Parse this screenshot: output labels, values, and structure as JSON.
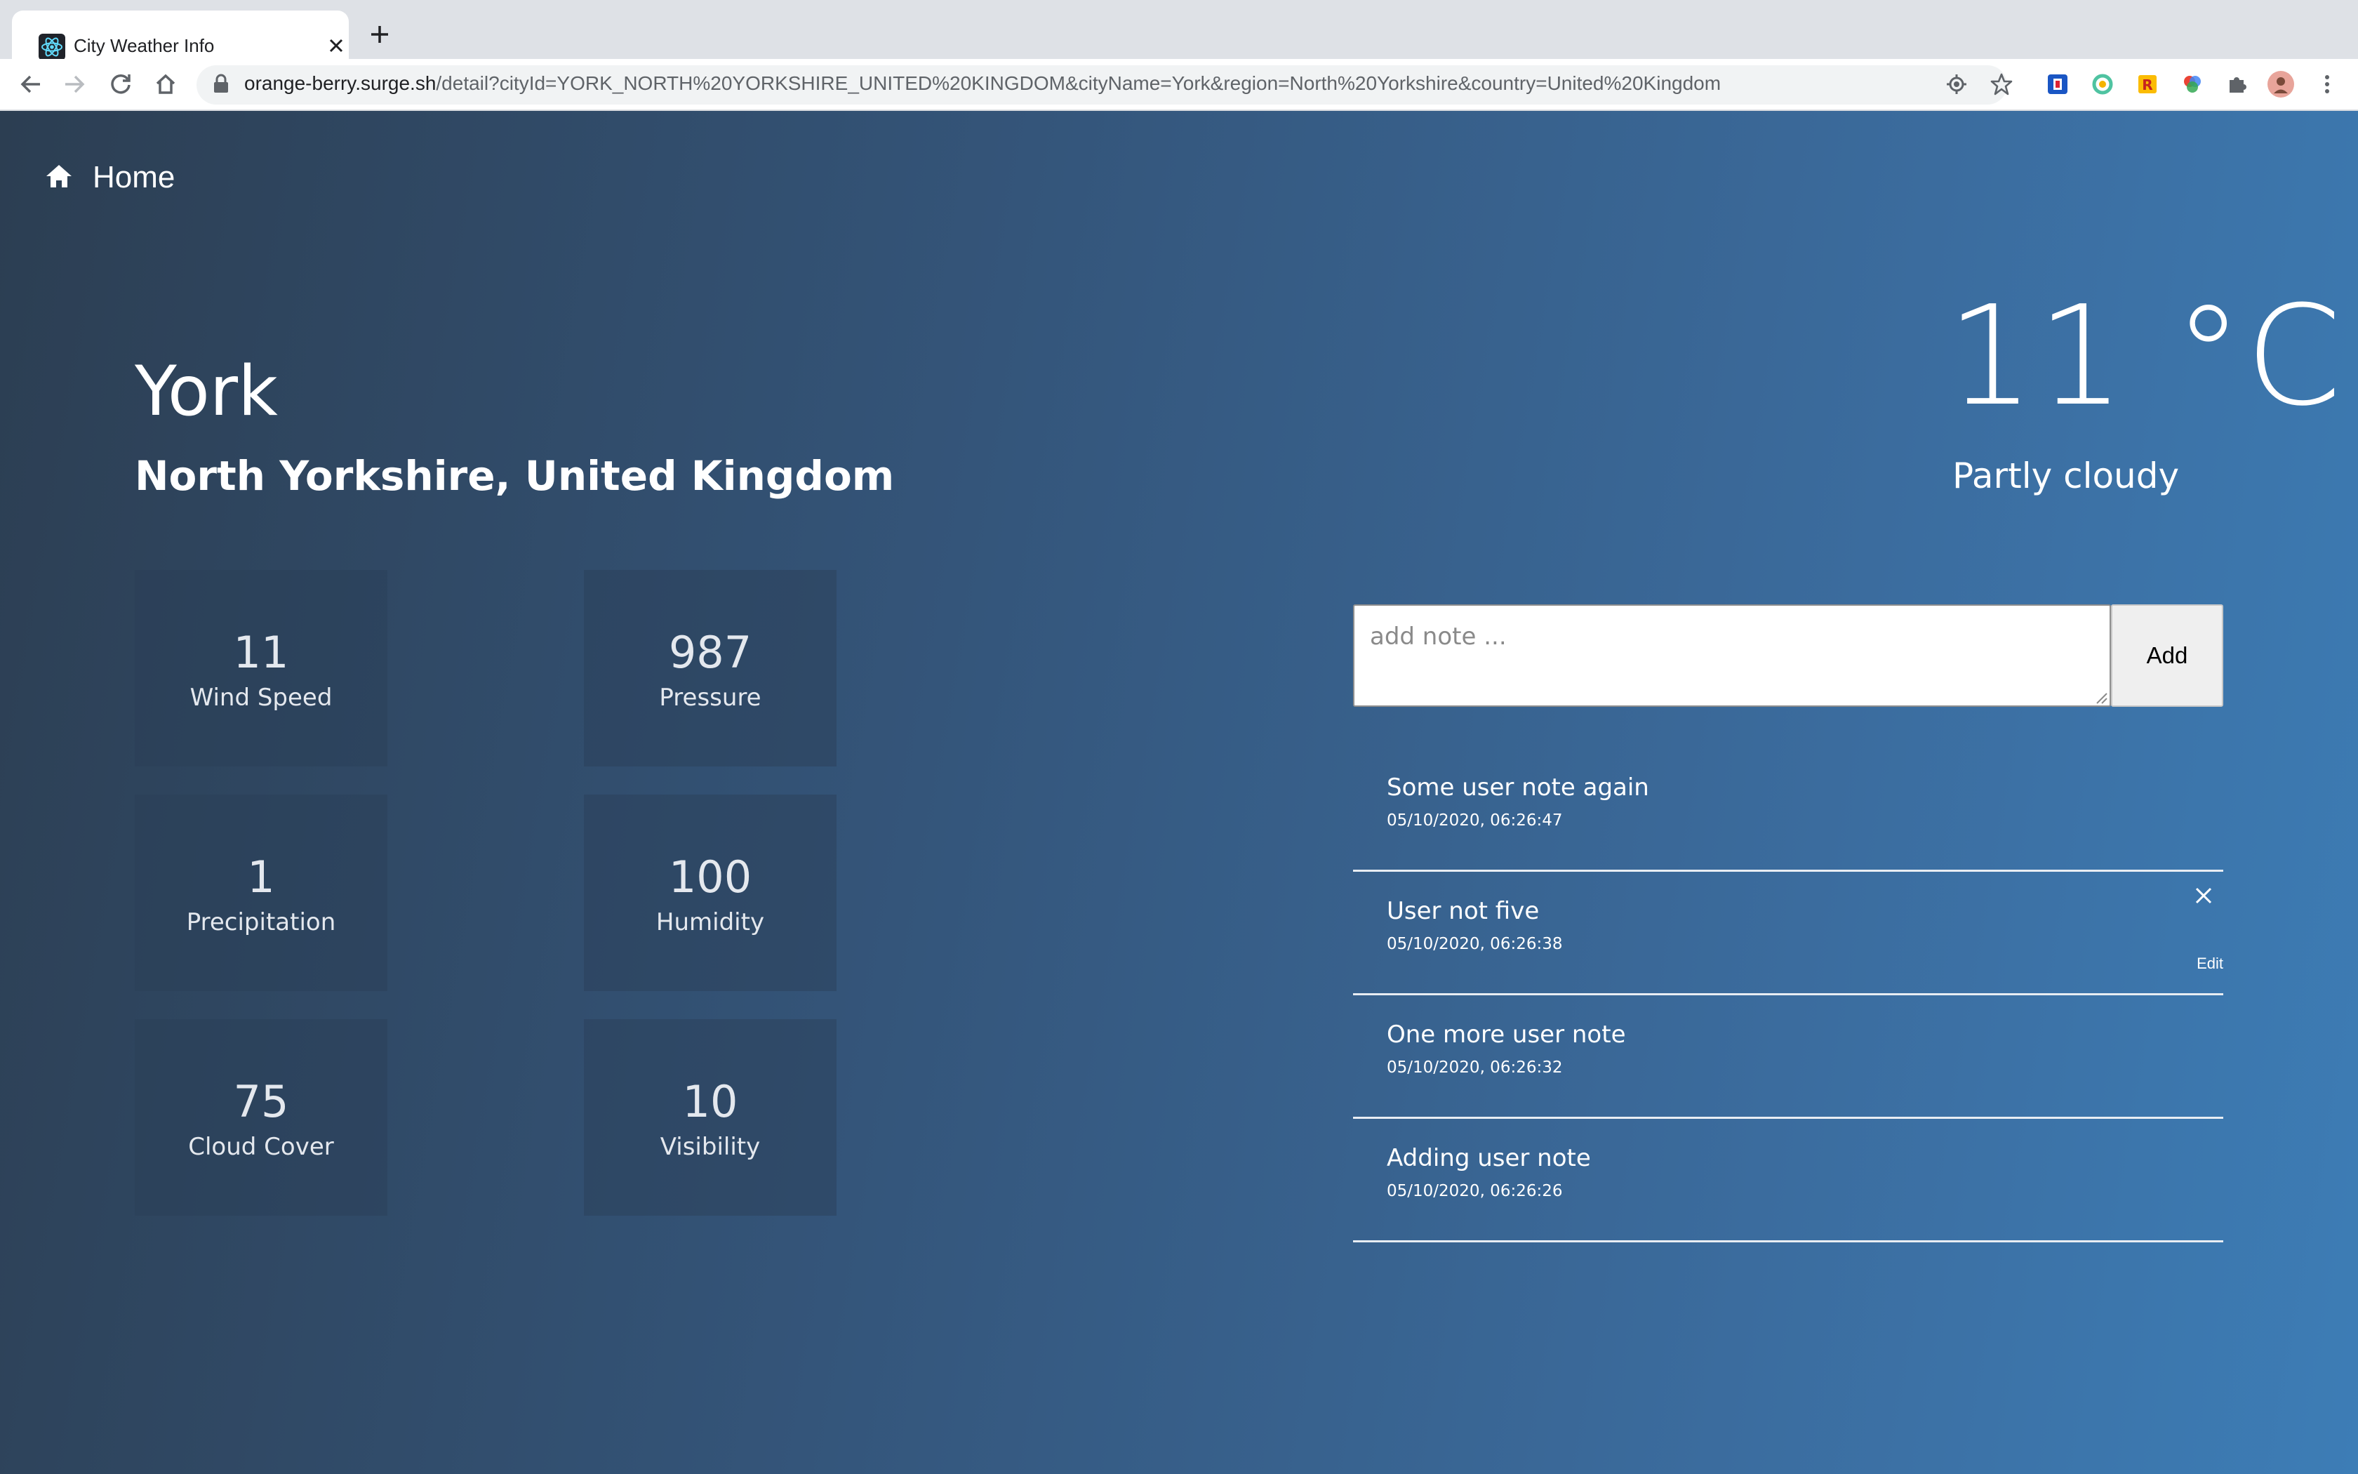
{
  "browser": {
    "tab_title": "City Weather Info",
    "url_host": "orange-berry.surge.sh",
    "url_path": "/detail?cityId=YORK_NORTH%20YORKSHIRE_UNITED%20KINGDOM&cityName=York&region=North%20Yorkshire&country=United%20Kingdom"
  },
  "nav": {
    "home_label": "Home"
  },
  "city": {
    "name": "York",
    "region": "North Yorkshire, United Kingdom"
  },
  "weather": {
    "temperature": "11 °C",
    "condition": "Partly cloudy"
  },
  "stats": [
    {
      "value": "11",
      "label": "Wind Speed"
    },
    {
      "value": "987",
      "label": "Pressure"
    },
    {
      "value": "1",
      "label": "Precipitation"
    },
    {
      "value": "100",
      "label": "Humidity"
    },
    {
      "value": "75",
      "label": "Cloud Cover"
    },
    {
      "value": "10",
      "label": "Visibility"
    }
  ],
  "notes_form": {
    "placeholder": "add note ...",
    "value": "",
    "add_label": "Add"
  },
  "notes": [
    {
      "text": "Some user note again",
      "time": "05/10/2020, 06:26:47"
    },
    {
      "text": "User not five",
      "time": "05/10/2020, 06:26:38",
      "edit_label": "Edit"
    },
    {
      "text": "One more user note",
      "time": "05/10/2020, 06:26:32"
    },
    {
      "text": "Adding user note",
      "time": "05/10/2020, 06:26:26"
    }
  ],
  "colors": {
    "gradient_start": "#2c3e52",
    "gradient_end": "#3d7db6",
    "stat_tile": "#34495f"
  }
}
